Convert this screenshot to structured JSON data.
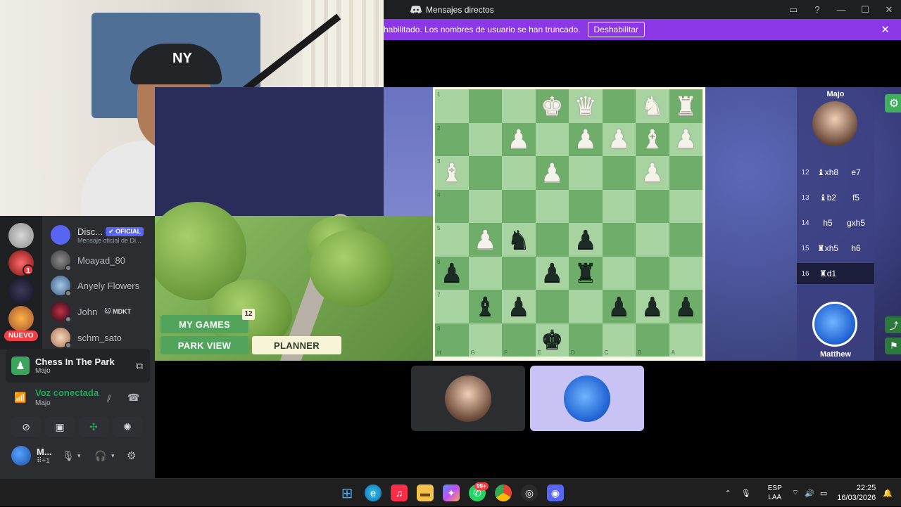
{
  "window": {
    "title": "Mensajes directos",
    "controls": [
      "▭",
      "?",
      "—",
      "☐",
      "✕"
    ]
  },
  "notice": {
    "text": "habilitado. Los nombres de usuario se han truncado.",
    "button": "Deshabilitar",
    "close": "✕"
  },
  "sidebar": {
    "nuevo": "NUEVO",
    "server_badge": "1",
    "dms": [
      {
        "name": "Disc...",
        "tag": "✔ OFICIAL",
        "sub": "Mensaje oficial de Di..."
      },
      {
        "name": "Moayad_80"
      },
      {
        "name": "Anyely Flowers"
      },
      {
        "name": "John",
        "tag": "🐱 MDKT"
      },
      {
        "name": "schm_sato"
      }
    ],
    "activity": {
      "title": "Chess In The Park",
      "sub": "Majo"
    },
    "voice": {
      "status": "Voz conectada",
      "sub": "Majo"
    },
    "user": {
      "name": "M...",
      "sub": "⠿+1"
    }
  },
  "game": {
    "my_games": "MY GAMES",
    "my_games_badge": "12",
    "park_view": "PARK VIEW",
    "planner": "PLANNER",
    "ranks": [
      "1",
      "2",
      "3",
      "4",
      "5",
      "6",
      "7",
      "8"
    ],
    "files": [
      "H",
      "G",
      "F",
      "E",
      "D",
      "C",
      "B",
      "A"
    ],
    "pieces": {
      "white": [
        {
          "sq": "E1",
          "g": "♚"
        },
        {
          "sq": "D1",
          "g": "♛"
        },
        {
          "sq": "B1",
          "g": "♞"
        },
        {
          "sq": "A1",
          "g": "♜"
        },
        {
          "sq": "F2",
          "g": "♟"
        },
        {
          "sq": "D2",
          "g": "♟"
        },
        {
          "sq": "C2",
          "g": "♟"
        },
        {
          "sq": "B2",
          "g": "♝"
        },
        {
          "sq": "A2",
          "g": "♟"
        },
        {
          "sq": "H3",
          "g": "♝"
        },
        {
          "sq": "E3",
          "g": "♟"
        },
        {
          "sq": "B3",
          "g": "♟"
        },
        {
          "sq": "G5",
          "g": "♟"
        }
      ],
      "black": [
        {
          "sq": "F5",
          "g": "♞"
        },
        {
          "sq": "D5",
          "g": "♟"
        },
        {
          "sq": "H6",
          "g": "♟"
        },
        {
          "sq": "E6",
          "g": "♟"
        },
        {
          "sq": "D6",
          "g": "♜"
        },
        {
          "sq": "G7",
          "g": "♝"
        },
        {
          "sq": "F7",
          "g": "♟"
        },
        {
          "sq": "C7",
          "g": "♟"
        },
        {
          "sq": "B7",
          "g": "♟"
        },
        {
          "sq": "A7",
          "g": "♟"
        },
        {
          "sq": "E8",
          "g": "♚"
        }
      ]
    },
    "players": {
      "top": "Majo",
      "bottom": "Matthew"
    },
    "moves": [
      {
        "n": "12",
        "a": "♝xh8",
        "b": "e7"
      },
      {
        "n": "13",
        "a": "♝b2",
        "b": "f5"
      },
      {
        "n": "14",
        "a": "h5",
        "b": "gxh5"
      },
      {
        "n": "15",
        "a": "♜xh5",
        "b": "h6"
      },
      {
        "n": "16",
        "a": "♜d1",
        "b": ""
      }
    ]
  },
  "taskbar": {
    "whatsapp_badge": "99+",
    "lang_1": "ESP",
    "lang_2": "LAA",
    "time": "22:25",
    "date": "16/03/2026"
  },
  "colors": {
    "discord_bg": "#2b2d31",
    "notice": "#8b37e6",
    "board_light": "#a7d3a0",
    "board_dark": "#6fae6a",
    "green_button": "#52a35b",
    "voice_green": "#23a55a"
  }
}
